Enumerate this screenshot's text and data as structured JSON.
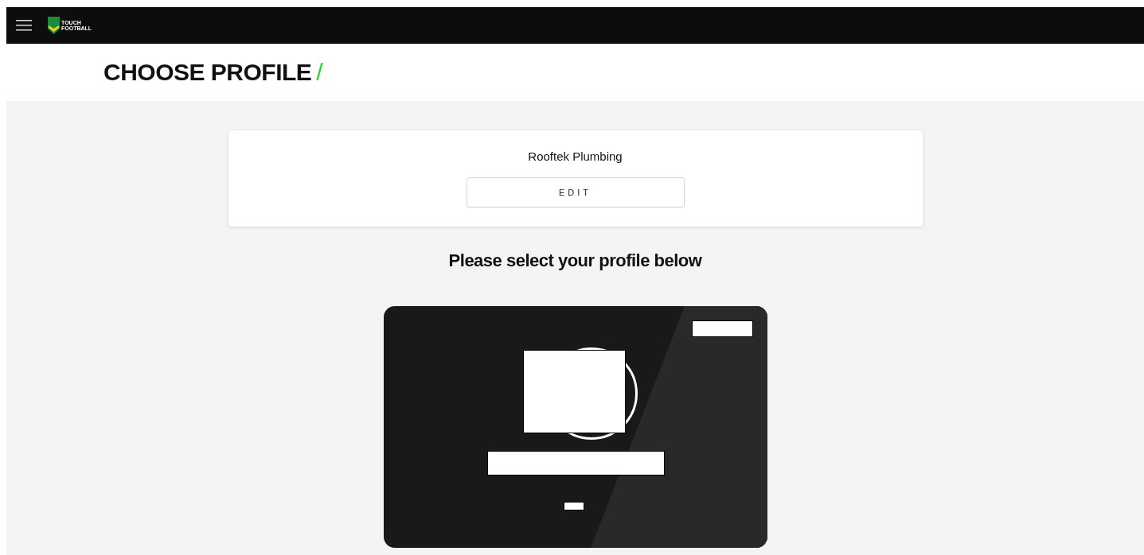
{
  "app_bar": {
    "logo_lines": [
      "TOUCH",
      "FOOTBALL"
    ]
  },
  "page_title": {
    "text": "CHOOSE PROFILE",
    "mark": "/"
  },
  "organisation": {
    "name": "Rooftek Plumbing",
    "edit_button": "EDIT"
  },
  "prompt": "Please select your profile below",
  "profile_cards": [
    {
      "kind": "redacted"
    }
  ]
}
